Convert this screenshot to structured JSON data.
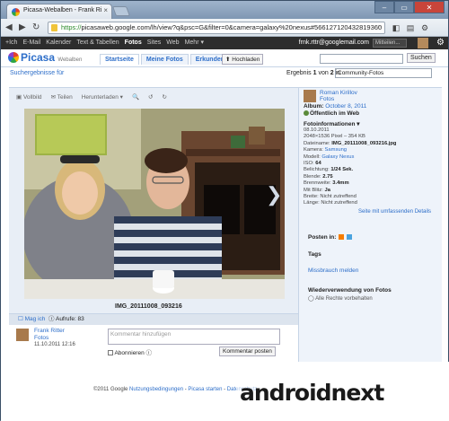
{
  "browser": {
    "tab_title": "Picasa-Webalben - Frank Ri",
    "tab_close": "×",
    "url_scheme": "https://",
    "url_rest": "picasaweb.google.com/lh/view?q&psc=G&filter=0&camera=galaxy%20nexus#566127120432819360",
    "window_controls": [
      "–",
      "▭",
      "✕"
    ]
  },
  "google_bar": {
    "links": [
      "+Ich",
      "E-Mail",
      "Kalender",
      "Text & Tabellen",
      "Fotos",
      "Sites",
      "Web",
      "Mehr ▾"
    ],
    "active": "Fotos",
    "user": "frnk.rttr@googlemail.com",
    "share_label": "Mitteilen..."
  },
  "picasa": {
    "logo": "Picasa",
    "logo_sub": "Webalben",
    "tabs": [
      "Startseite",
      "Meine Fotos",
      "Erkunden"
    ],
    "upload": "Hochladen",
    "search_button": "Suchen"
  },
  "results": {
    "back_link": "Suchergebnisse für",
    "count_prefix": "Ergebnis",
    "count_current": "1",
    "count_mid": "von",
    "count_total": "2",
    "count_suffix": "in",
    "filter": "Community-Fotos"
  },
  "toolbar": {
    "fullscreen": "Vollbild",
    "share": "Teilen",
    "download": "Herunterladen ▾"
  },
  "photo": {
    "caption": "IMG_20111008_093216"
  },
  "tagbar": {
    "like": "Mag ich",
    "views": "Aufrufe: 83"
  },
  "comment": {
    "author": "Frank Ritter",
    "author_sub": "Fotos",
    "date": "11.10.2011 12:16",
    "placeholder": "Kommentar hinzufügen",
    "subscribe": "Abonnieren",
    "post": "Kommentar posten"
  },
  "side": {
    "owner_name": "Roman Kirillov",
    "owner_sub": "Fotos",
    "album_label": "Album:",
    "album_link": "October 8, 2011",
    "public": "Öffentlich im Web",
    "info_header": "Fotoinformationen ▾",
    "info": {
      "date": "08.10.2011",
      "size": "2048×1536 Pixel – 354 KB",
      "filename_k": "Dateiname:",
      "filename_v": "IMG_20111008_093216.jpg",
      "camera_k": "Kamera:",
      "camera_v": "Samsung",
      "model_k": "Modell:",
      "model_v": "Galaxy Nexus",
      "iso_k": "ISO:",
      "iso_v": "64",
      "exposure_k": "Belichtung:",
      "exposure_v": "1/24 Sek.",
      "aperture_k": "Blende:",
      "aperture_v": "2.75",
      "focal_k": "Brennweite:",
      "focal_v": "3.4mm",
      "flash_k": "Mit Blitz:",
      "flash_v": "Ja",
      "lat_k": "Breite:",
      "lat_v": "Nicht zutreffend",
      "lon_k": "Länge:",
      "lon_v": "Nicht zutreffend"
    },
    "more_link": "Seite mit umfassenden Details",
    "post_in": "Posten in:",
    "tags": "Tags",
    "report": "Missbrauch melden",
    "reuse": "Wiederverwendung von Fotos",
    "rights": "Alle Rechte vorbehalten"
  },
  "footer": {
    "copyright": "©2011 Google",
    "terms": "Nutzungsbedingungen",
    "sep1": "-",
    "start": "Picasa starten",
    "sep2": "-",
    "privacy": "Datenschutz"
  },
  "watermark": "androidnext"
}
